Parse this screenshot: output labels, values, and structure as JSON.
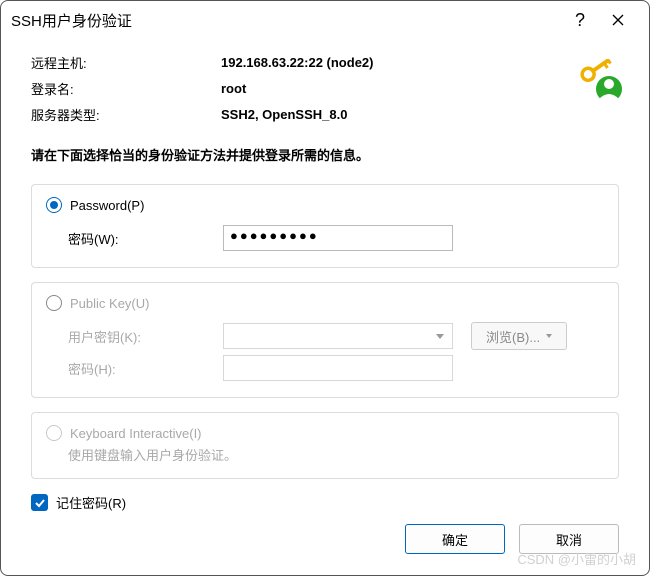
{
  "title": "SSH用户身份验证",
  "info": {
    "remote_host_label": "远程主机:",
    "remote_host_value": "192.168.63.22:22 (node2)",
    "login_label": "登录名:",
    "login_value": "root",
    "server_type_label": "服务器类型:",
    "server_type_value": "SSH2, OpenSSH_8.0"
  },
  "instruction": "请在下面选择恰当的身份验证方法并提供登录所需的信息。",
  "password_group": {
    "radio_label": "Password(P)",
    "password_label": "密码(W):",
    "password_value": "●●●●●●●●●"
  },
  "publickey_group": {
    "radio_label": "Public Key(U)",
    "userkey_label": "用户密钥(K):",
    "passphrase_label": "密码(H):",
    "browse_label": "浏览(B)..."
  },
  "keyboard_group": {
    "radio_label": "Keyboard Interactive(I)",
    "desc": "使用键盘输入用户身份验证。"
  },
  "remember_label": "记住密码(R)",
  "buttons": {
    "ok": "确定",
    "cancel": "取消"
  },
  "watermark": "CSDN @小雷的小胡"
}
